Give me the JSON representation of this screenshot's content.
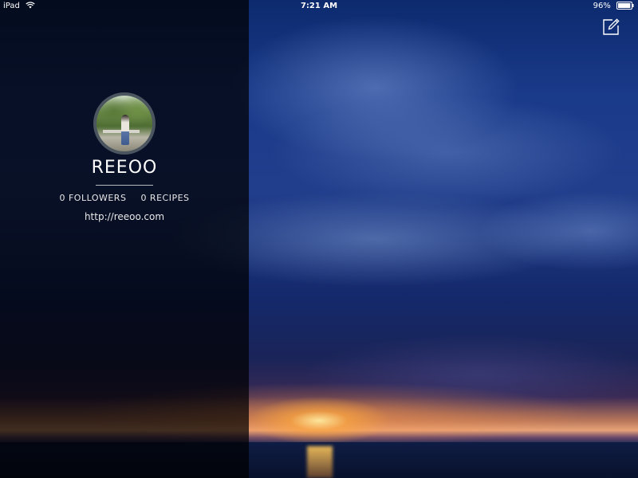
{
  "status_bar": {
    "carrier": "iPad",
    "time": "7:21 AM",
    "battery_percent": "96%",
    "battery_level": 0.96,
    "icons": [
      "wifi-icon",
      "battery-icon"
    ]
  },
  "toolbar": {
    "compose_icon": "compose-icon"
  },
  "profile": {
    "name": "REEOO",
    "followers": "0 FOLLOWERS",
    "recipes": "0 RECIPES",
    "website": "http://reeoo.com"
  },
  "colors": {
    "panel_overlay": "#000000",
    "text": "#ffffff",
    "avatar_ring": "#4a5560"
  }
}
